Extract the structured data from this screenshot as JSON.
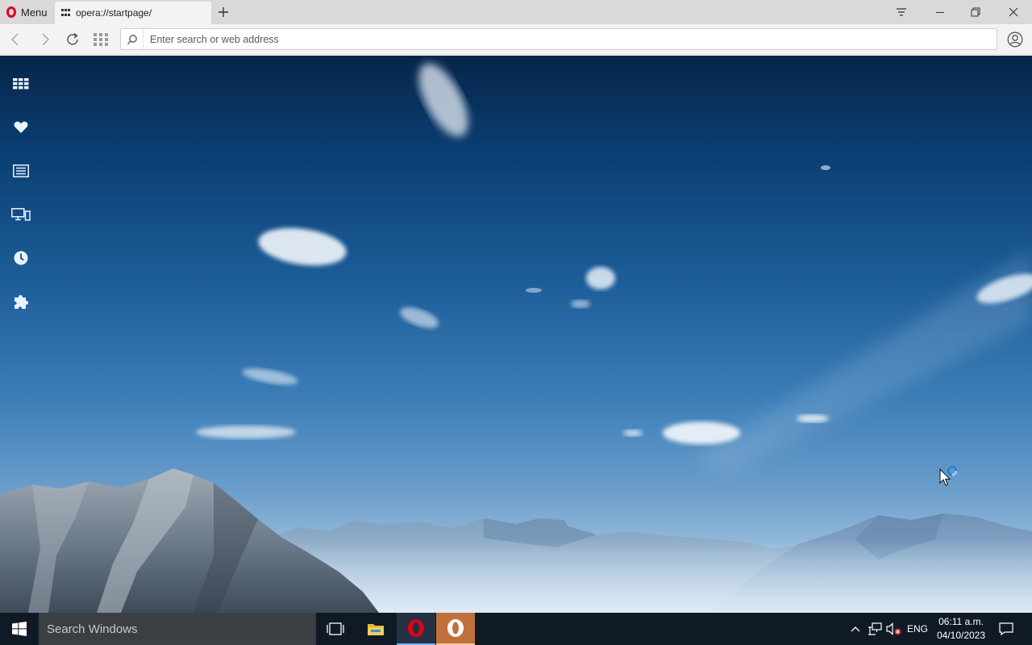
{
  "browser": {
    "menu_label": "Menu",
    "tab_title": "opera://startpage/",
    "address_placeholder": "Enter search or web address"
  },
  "icons": {
    "menu": "opera-logo-icon",
    "tab": "speed-dial-icon",
    "new_tab": "plus-icon",
    "sidebar": [
      "speed-dial-icon",
      "heart-icon",
      "news-icon",
      "devices-icon",
      "history-icon",
      "extensions-icon"
    ],
    "window": [
      "tab-menu-icon",
      "minimize-icon",
      "restore-icon",
      "close-icon"
    ]
  },
  "colors": {
    "opera_red": "#e0001b",
    "sidebar_icon": "#e8f3ff",
    "taskbar": "#0f1a25",
    "search_box": "#3b3f44",
    "active_app_highlight": "#c0703a"
  },
  "taskbar": {
    "search_placeholder": "Search Windows",
    "language": "ENG",
    "time": "06:11 a.m.",
    "date": "04/10/2023"
  }
}
